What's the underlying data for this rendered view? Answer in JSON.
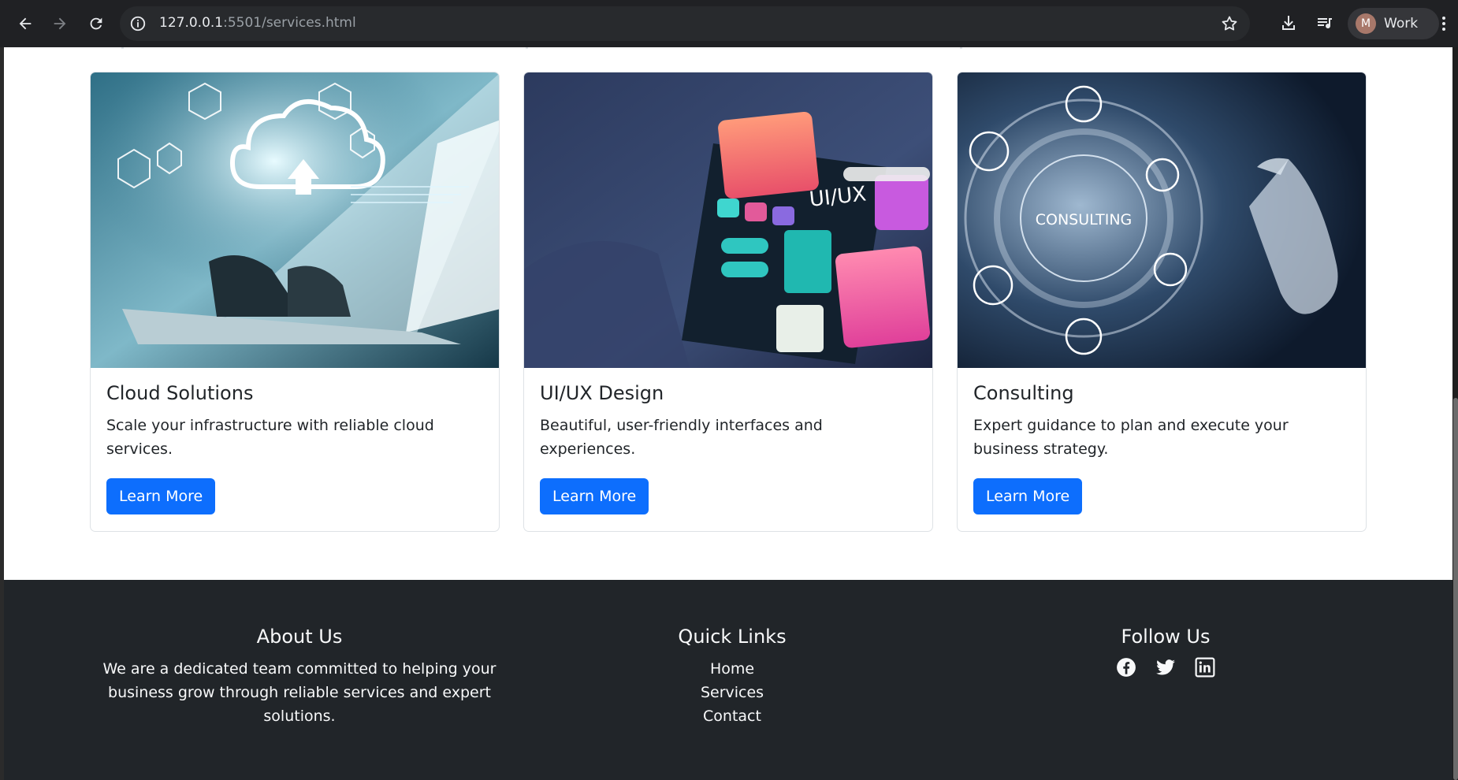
{
  "browser": {
    "url_host": "127.0.0.1",
    "url_path": ":5501/services.html",
    "profile_initial": "M",
    "profile_name": "Work"
  },
  "cards": [
    {
      "title": "Cloud Solutions",
      "text": "Scale your infrastructure with reliable cloud services.",
      "button": "Learn More",
      "image": "cloud-laptop-image"
    },
    {
      "title": "UI/UX Design",
      "text": "Beautiful, user-friendly interfaces and experiences.",
      "button": "Learn More",
      "image": "uiux-phone-image",
      "image_text": "UI/UX"
    },
    {
      "title": "Consulting",
      "text": "Expert guidance to plan and execute your business strategy.",
      "button": "Learn More",
      "image": "consulting-hud-image",
      "image_text": "CONSULTING"
    }
  ],
  "footer": {
    "about": {
      "heading": "About Us",
      "text": "We are a dedicated team committed to helping your business grow through reliable services and expert solutions."
    },
    "links": {
      "heading": "Quick Links",
      "items": [
        "Home",
        "Services",
        "Contact"
      ]
    },
    "follow": {
      "heading": "Follow Us",
      "icons": [
        "facebook-icon",
        "twitter-icon",
        "linkedin-icon"
      ]
    }
  },
  "colors": {
    "primary": "#0d6efd",
    "footer_bg": "#212529",
    "chrome_bg": "#202124"
  }
}
